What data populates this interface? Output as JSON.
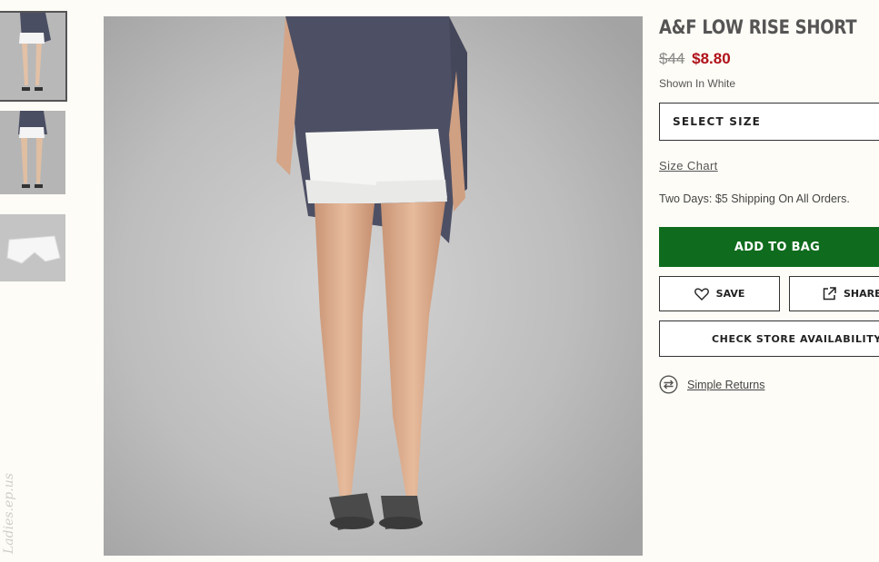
{
  "product": {
    "title": "A&F LOW RISE SHORT",
    "price_original": "$44",
    "price_sale": "$8.80",
    "color_note": "Shown In White"
  },
  "size_select": {
    "label": "SELECT SIZE"
  },
  "size_chart": {
    "label": "Size Chart"
  },
  "shipping": {
    "text": "Two Days: $5 Shipping On All Orders."
  },
  "actions": {
    "add_to_bag": "ADD TO BAG",
    "save": "SAVE",
    "share": "SHARE",
    "check_store": "CHECK STORE AVAILABILITY"
  },
  "returns": {
    "label": "Simple Returns"
  },
  "watermark": {
    "text": "Ladies.ep.us"
  },
  "icons": {
    "save": "heart-icon",
    "share": "external-share-icon",
    "returns": "exchange-arrows-icon"
  },
  "colors": {
    "add_to_bag": "#0f6b1d",
    "sale_price": "#b0101a",
    "background": "#fdfcf6"
  }
}
